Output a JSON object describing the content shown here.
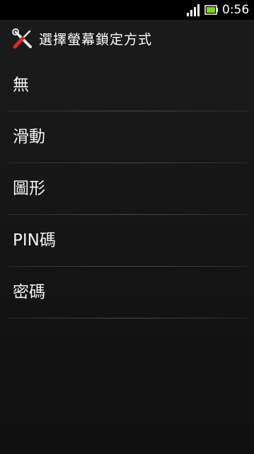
{
  "status_bar": {
    "time": "0:56",
    "signal_icon": "signal-icon",
    "battery_icon": "battery-icon"
  },
  "title_bar": {
    "icon": "tools-icon",
    "title": "選擇螢幕鎖定方式"
  },
  "options": [
    {
      "label": "無"
    },
    {
      "label": "滑動"
    },
    {
      "label": "圖形"
    },
    {
      "label": "PIN碼"
    },
    {
      "label": "密碼"
    }
  ],
  "colors": {
    "background": "#141414",
    "text": "#f2f2f2",
    "divider": "#4a4a4a",
    "tools_accent": "#d62b2b"
  }
}
